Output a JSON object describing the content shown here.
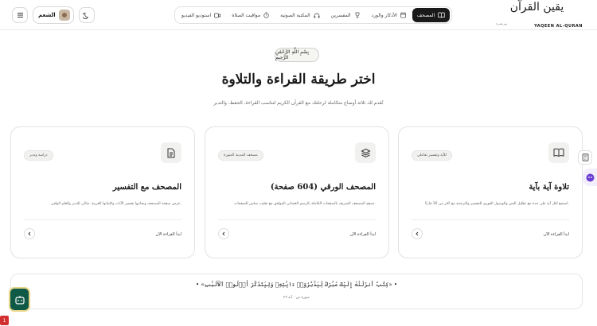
{
  "header": {
    "user_name": "الشعم",
    "nav": [
      {
        "label": "المصحف",
        "icon": "book-icon",
        "active": true
      },
      {
        "label": "الأذكار والورد",
        "icon": "calendar-icon"
      },
      {
        "label": "المفسرين",
        "icon": "trophy-icon"
      },
      {
        "label": "المكتبة الصوتية",
        "icon": "headphones-icon"
      },
      {
        "label": "مواقيت الصلاة",
        "icon": "timer-icon"
      },
      {
        "label": "استوديو الفيديو",
        "icon": "video-icon"
      }
    ],
    "logo_ar": "يقين القرآن",
    "logo_en": "YAQEEN AL-QURAN",
    "logo_sub": "نور يضيء"
  },
  "hero": {
    "basmala": "بِسْمِ اللَّهِ الرَّحْمَٰنِ الرَّحِيمِ",
    "title": "اختر طريقة القراءة والتلاوة",
    "subtitle": "نُقدم لك ثلاثة أوضاع متكاملة لرحلتك مع القرآن الكريم لتناسب القراءة، الحفظ، والتدبر"
  },
  "cards": [
    {
      "icon": "document-icon",
      "badge": "دراسة وتدبر",
      "title": "المصحف مع التفسير",
      "desc": "عرض صفحة المصحف وبجانبها تفسير الآيات وكلماتها الغريبة، مثالي للتدبر والعلم الوافي.",
      "action": "ابدأ القراءة الآن"
    },
    {
      "icon": "layers-icon",
      "badge": "مصحف المدينة المنورة",
      "title": "المصحف الورقي (604 صفحة)",
      "desc": "تصفح المصحف الشريف بالصفحات الكاملة بالرسم العثماني الموافق مع تقليب سلس للصفحات.",
      "action": "ابدأ القراءة الآن"
    },
    {
      "icon": "open-book-icon",
      "badge": "للآية وتفسير تفاعلي",
      "title": "تلاوة آية بآية",
      "desc": "استمع لكل آية على حدة مع تظليل النص والوصول الفوري للتفسير والترجمة مع أكثر من 30 قارئًا.",
      "action": "ابدأ القراءة الآن"
    }
  ],
  "verse": {
    "text": "• «كِتَٰبٌ أَنزَلْنَٰهُ إِلَيْكَ مُبَٰرَكٌ لِّيَدَّبَّرُوٓا۟ ءَايَٰتِهِۦ وَلِيَتَذَكَّرَ أُو۟لُوا۟ ٱلْأَلْبَٰبِ» •",
    "ref": "سورة ص - آية ٢٩"
  },
  "error_count": "1"
}
